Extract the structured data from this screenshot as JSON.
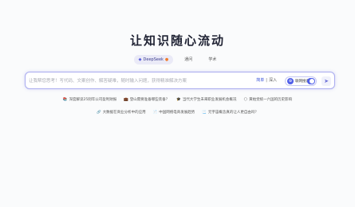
{
  "hero": {
    "title": "让知识随心流动"
  },
  "model_tabs": [
    {
      "label": "DeepSeek",
      "icon": "deepseek-whale-icon",
      "badge_icon": "fire-icon",
      "active": true
    },
    {
      "label": "通问",
      "active": false
    },
    {
      "label": "学术",
      "active": false
    }
  ],
  "search": {
    "placeholder": "让我帮您思考！写代码、文案创作、解答疑难，随时输入问题，获得精准解决方案",
    "value": "",
    "mode_simple": "简单",
    "mode_divider": "|",
    "mode_deep": "深入",
    "net_toggle_label": "联网搜索",
    "net_toggle_on": true,
    "send_icon": "paper-plane-icon"
  },
  "suggestions_row1": [
    {
      "icon": "📚",
      "text": "深度解读25则年公司盈利财报"
    },
    {
      "icon": "💼",
      "text": "登山需要准备哪些装备？"
    },
    {
      "icon": "🎓",
      "text": "当代大学生未来职业发展机会概况"
    },
    {
      "icon": "🌕",
      "text": "黄帕觉统一六国的历史影响"
    }
  ],
  "suggestions_row2": [
    {
      "icon": "🔗",
      "text": "大数据在商业分析中的应用"
    },
    {
      "icon": "📄",
      "text": "中国网络电商发展趋势"
    },
    {
      "icon": "📃",
      "text": "元宇宙概念真的让人更自由吗？"
    }
  ],
  "colors": {
    "accent": "#4f5ee8",
    "border": "#a9abef",
    "title": "#1f2233"
  }
}
